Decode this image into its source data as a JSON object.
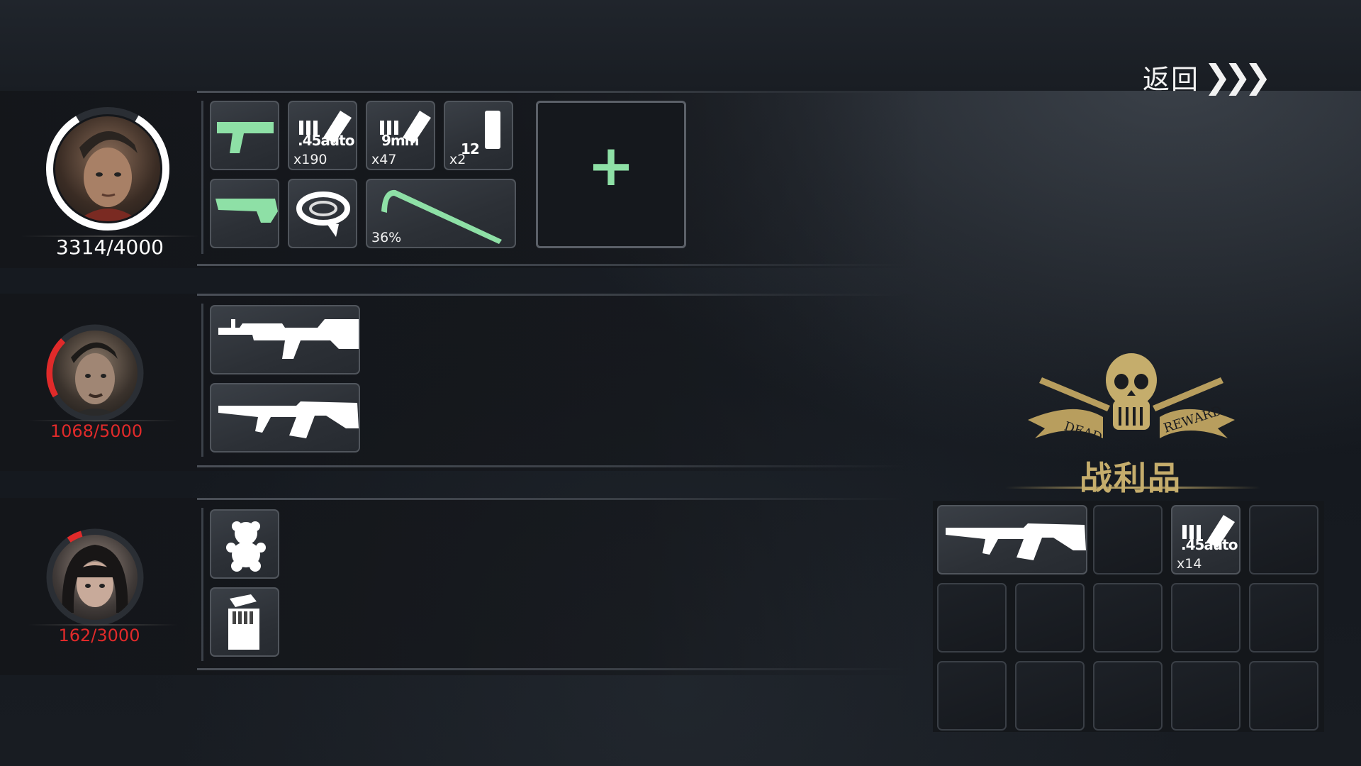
{
  "header": {
    "back_label": "返回",
    "back_chevrons": "❯❯❯"
  },
  "colors": {
    "accent_green": "#8ee0a6",
    "hp_low": "#e02a2a",
    "gold": "#c5ad6c",
    "white": "#ffffff"
  },
  "survivors": [
    {
      "hp_text": "3314/4000",
      "hp_fraction": 0.83,
      "ring_color": "#ffffff",
      "items": [
        {
          "icon": "pistol-icon"
        },
        {
          "icon": "ammo-45auto-icon",
          "caliber": ".45auto",
          "qty": "x190"
        },
        {
          "icon": "ammo-9mm-icon",
          "caliber": "9mm",
          "qty": "x47"
        },
        {
          "icon": "shotgun-shell-icon",
          "caliber": "12",
          "qty": "x2"
        },
        {
          "icon": "shotgun-icon"
        },
        {
          "icon": "bandage-roll-icon"
        },
        {
          "icon": "crowbar-icon",
          "durability": "36%"
        }
      ],
      "add_label": "+"
    },
    {
      "hp_text": "1068/5000",
      "hp_fraction": 0.21,
      "ring_color": "#e02a2a",
      "items": [
        {
          "icon": "machine-gun-icon"
        },
        {
          "icon": "ak47-icon"
        }
      ]
    },
    {
      "hp_text": "162/3000",
      "hp_fraction": 0.05,
      "ring_color": "#e02a2a",
      "items": [
        {
          "icon": "teddy-bear-icon"
        },
        {
          "icon": "cigarette-pack-icon"
        }
      ]
    }
  ],
  "loot": {
    "emblem_text_left": "DEAD",
    "emblem_text_right": "REWARD",
    "title": "战利品",
    "items": [
      {
        "icon": "ak47-icon"
      },
      {
        "icon": "empty"
      },
      {
        "icon": "ammo-45auto-icon",
        "caliber": ".45auto",
        "qty": "x14"
      }
    ]
  }
}
